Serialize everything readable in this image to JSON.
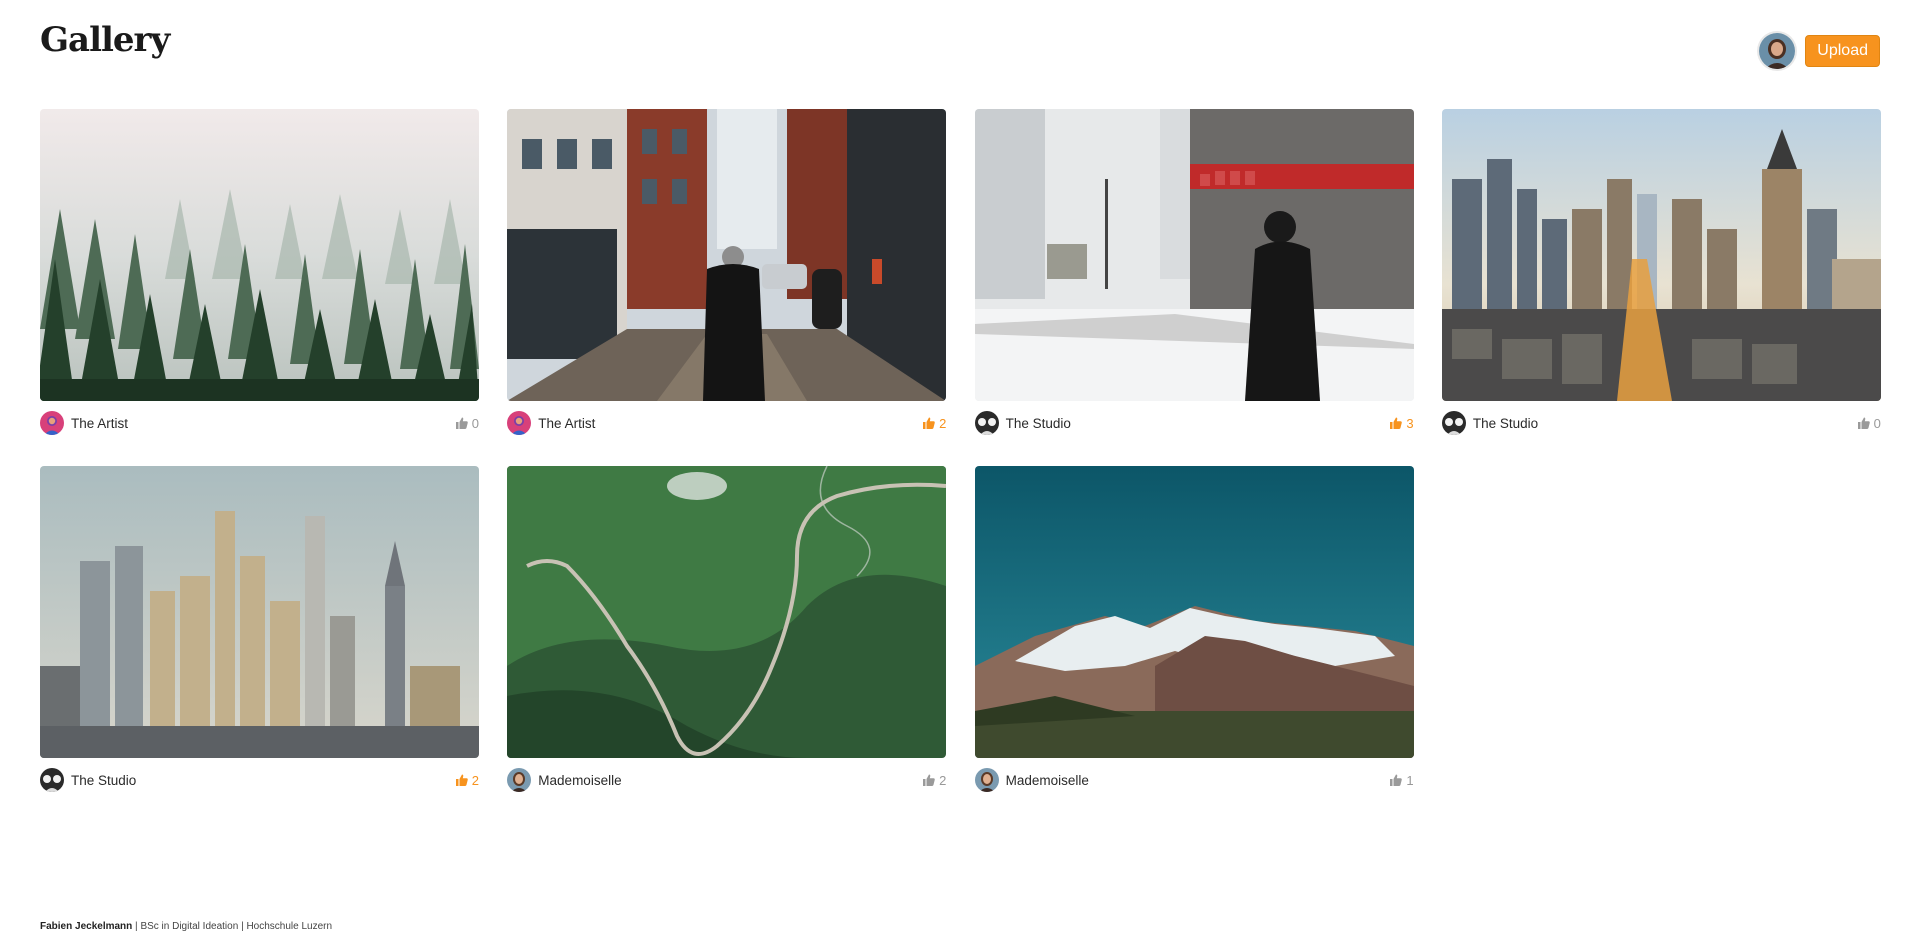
{
  "header": {
    "title": "Gallery",
    "upload_label": "Upload",
    "avatar_icon": "user-avatar"
  },
  "accent_color": "#f7931e",
  "photos": [
    {
      "author": "The Artist",
      "author_avatar": "artist",
      "likes": "0",
      "liked": false,
      "scene": "misty-forest"
    },
    {
      "author": "The Artist",
      "author_avatar": "artist",
      "likes": "2",
      "liked": true,
      "scene": "street-alley"
    },
    {
      "author": "The Studio",
      "author_avatar": "studio",
      "likes": "3",
      "liked": true,
      "scene": "snowy-street"
    },
    {
      "author": "The Studio",
      "author_avatar": "studio",
      "likes": "0",
      "liked": false,
      "scene": "city-skyline"
    },
    {
      "author": "The Studio",
      "author_avatar": "studio",
      "likes": "2",
      "liked": true,
      "scene": "skyscrapers"
    },
    {
      "author": "Mademoiselle",
      "author_avatar": "mademoiselle",
      "likes": "2",
      "liked": false,
      "scene": "mountain-road"
    },
    {
      "author": "Mademoiselle",
      "author_avatar": "mademoiselle",
      "likes": "1",
      "liked": false,
      "scene": "snowy-mountains"
    }
  ],
  "footer": {
    "name": "Fabien Jeckelmann",
    "separator1": "|",
    "program": "BSc in Digital Ideation",
    "separator2": "|",
    "school": "Hochschule Luzern"
  }
}
